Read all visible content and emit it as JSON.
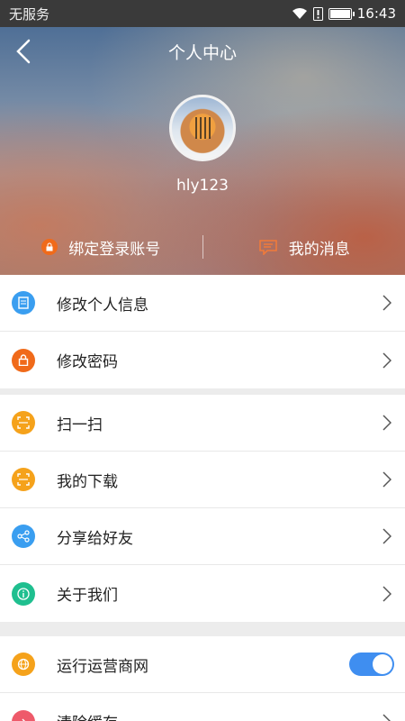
{
  "status_bar": {
    "carrier": "无服务",
    "time": "16:43"
  },
  "header": {
    "title": "个人中心",
    "username": "hly123"
  },
  "hero_actions": {
    "bind_account": "绑定登录账号",
    "my_messages": "我的消息"
  },
  "group1": [
    {
      "label": "修改个人信息",
      "icon": "document-icon",
      "color": "#3a9ef0"
    },
    {
      "label": "修改密码",
      "icon": "lock-icon",
      "color": "#f06a1a"
    }
  ],
  "group2": [
    {
      "label": "扫一扫",
      "icon": "scan-icon",
      "color": "#f5a21b"
    },
    {
      "label": "我的下载",
      "icon": "download-icon",
      "color": "#f5a21b"
    },
    {
      "label": "分享给好友",
      "icon": "share-icon",
      "color": "#3a9ef0"
    },
    {
      "label": "关于我们",
      "icon": "info-icon",
      "color": "#1fbf8f"
    }
  ],
  "group3": [
    {
      "label": "运行运营商网",
      "icon": "network-icon",
      "color": "#f5a21b",
      "toggle_on": true
    },
    {
      "label": "清除缓存",
      "icon": "clear-icon",
      "color": "#ee5a6a"
    }
  ]
}
